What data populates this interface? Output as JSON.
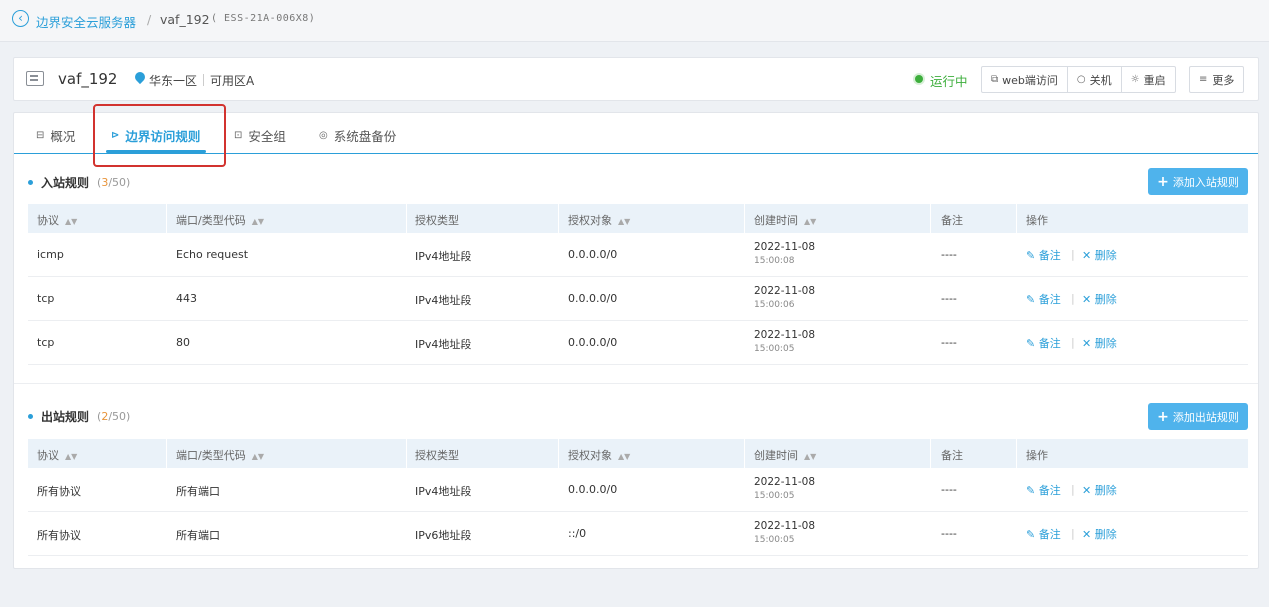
{
  "breadcrumb": {
    "root": "边界安全云服务器",
    "separator": "/",
    "current": "vaf_192",
    "id": "( ESS-21A-006X8)"
  },
  "instance": {
    "name": "vaf_192",
    "region": "华东一区",
    "zone": "可用区A",
    "status": "运行中",
    "status_color": "#3dae3c",
    "actions": {
      "web_access": "web端访问",
      "shutdown": "关机",
      "restart": "重启",
      "more": "更多"
    }
  },
  "tabs": [
    {
      "label": "概况",
      "icon": "overview-icon"
    },
    {
      "label": "边界访问规则",
      "icon": "rules-icon"
    },
    {
      "label": "安全组",
      "icon": "lock-icon"
    },
    {
      "label": "系统盘备份",
      "icon": "backup-icon"
    }
  ],
  "columns": [
    "协议",
    "端口/类型代码",
    "授权类型",
    "授权对象",
    "创建时间",
    "备注",
    "操作"
  ],
  "row_actions": {
    "note": "备注",
    "delete": "删除"
  },
  "inbound": {
    "title": "入站规则",
    "count_open": "(",
    "count_used": "3",
    "count_total": "/50)",
    "add_button": "添加入站规则",
    "rows": [
      {
        "protocol": "icmp",
        "port": "Echo request",
        "auth_type": "IPv4地址段",
        "auth_object": "0.0.0.0/0",
        "date": "2022-11-08",
        "time": "15:00:08",
        "note": "----"
      },
      {
        "protocol": "tcp",
        "port": "443",
        "auth_type": "IPv4地址段",
        "auth_object": "0.0.0.0/0",
        "date": "2022-11-08",
        "time": "15:00:06",
        "note": "----"
      },
      {
        "protocol": "tcp",
        "port": "80",
        "auth_type": "IPv4地址段",
        "auth_object": "0.0.0.0/0",
        "date": "2022-11-08",
        "time": "15:00:05",
        "note": "----"
      }
    ]
  },
  "outbound": {
    "title": "出站规则",
    "count_open": "(",
    "count_used": "2",
    "count_total": "/50)",
    "add_button": "添加出站规则",
    "rows": [
      {
        "protocol": "所有协议",
        "port": "所有端口",
        "auth_type": "IPv4地址段",
        "auth_object": "0.0.0.0/0",
        "date": "2022-11-08",
        "time": "15:00:05",
        "note": "----"
      },
      {
        "protocol": "所有协议",
        "port": "所有端口",
        "auth_type": "IPv6地址段",
        "auth_object": "::/0",
        "date": "2022-11-08",
        "time": "15:00:05",
        "note": "----"
      }
    ]
  },
  "colors": {
    "accent": "#2b9fd9",
    "add_button": "#4fb3ec",
    "highlight": "#d2332f"
  }
}
